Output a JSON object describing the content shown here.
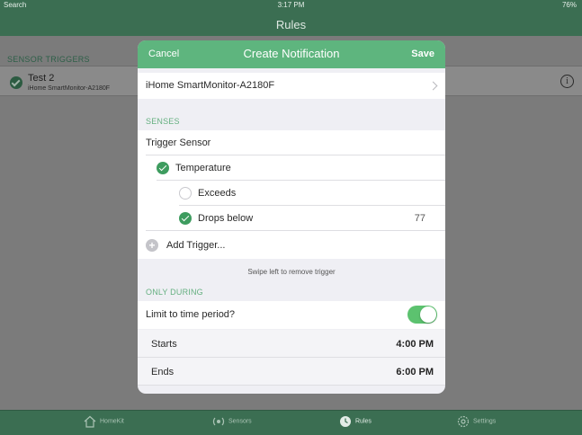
{
  "status_bar": {
    "carrier": "Search",
    "time": "3:17 PM",
    "battery": "76%"
  },
  "nav": {
    "title": "Rules"
  },
  "background": {
    "section_header": "SENSOR TRIGGERS",
    "trigger": {
      "title": "Test 2",
      "subtitle": "iHome SmartMonitor-A2180F",
      "info_icon": "i"
    }
  },
  "tabs": [
    {
      "label": "HomeKit",
      "icon": "house-icon"
    },
    {
      "label": "Sensors",
      "icon": "sensor-icon"
    },
    {
      "label": "Rules",
      "icon": "clock-icon",
      "active": true
    },
    {
      "label": "Settings",
      "icon": "gear-icon"
    }
  ],
  "modal": {
    "cancel": "Cancel",
    "title": "Create Notification",
    "save": "Save",
    "device": "iHome SmartMonitor-A2180F",
    "senses_label": "SENSES",
    "trigger_sensor": "Trigger Sensor",
    "temperature": "Temperature",
    "exceeds": "Exceeds",
    "drops_below": "Drops below",
    "drops_below_value": "77",
    "add_trigger": "Add Trigger...",
    "swipe_hint": "Swipe left to remove trigger",
    "only_during_label": "ONLY DURING",
    "limit_label": "Limit to time period?",
    "limit_enabled": true,
    "starts_label": "Starts",
    "starts_value": "4:00 PM",
    "ends_label": "Ends",
    "ends_value": "6:00 PM"
  },
  "colors": {
    "accent": "#5eb57e",
    "nav_green": "#3b6e52",
    "toggle_on": "#5cc26f"
  }
}
